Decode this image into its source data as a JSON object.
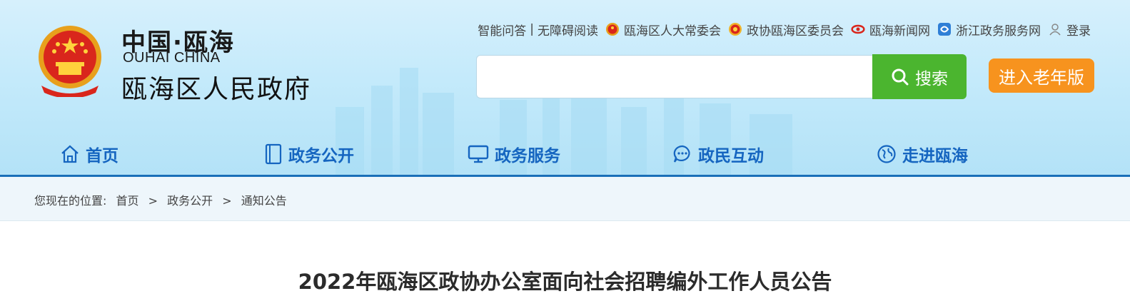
{
  "header": {
    "logo_cn": "中国·瓯海",
    "logo_en": "OUHAI CHINA",
    "site_name": "瓯海区人民政府"
  },
  "toplinks": {
    "qa": "智能问答",
    "separator": "|",
    "accessibility": "无障碍阅读",
    "npc": "瓯海区人大常委会",
    "cppcc": "政协瓯海区委员会",
    "news": "瓯海新闻网",
    "zj_service": "浙江政务服务网",
    "login": "登录"
  },
  "search": {
    "value": "",
    "button_label": "搜索"
  },
  "elder_mode_label": "进入老年版",
  "nav": {
    "items": [
      {
        "label": "首页",
        "icon": "home-icon"
      },
      {
        "label": "政务公开",
        "icon": "document-icon"
      },
      {
        "label": "政务服务",
        "icon": "monitor-icon"
      },
      {
        "label": "政民互动",
        "icon": "chat-icon"
      },
      {
        "label": "走进瓯海",
        "icon": "globe-icon"
      }
    ]
  },
  "breadcrumb": {
    "prefix": "您现在的位置:",
    "items": [
      "首页",
      "政务公开",
      "通知公告"
    ],
    "separator": ">"
  },
  "article": {
    "title": "2022年瓯海区政协办公室面向社会招聘编外工作人员公告"
  },
  "colors": {
    "nav_text": "#1565c0",
    "search_button": "#4bb52f",
    "elder_button": "#f7931e",
    "nav_underline": "#1a6fb8"
  }
}
